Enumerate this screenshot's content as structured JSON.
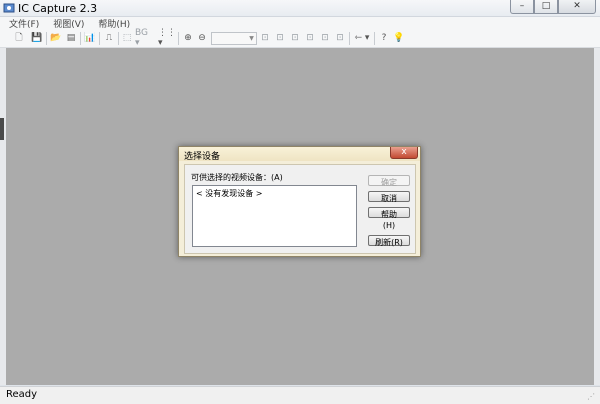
{
  "window": {
    "title": "IC Capture 2.3",
    "minimize_glyph": "–",
    "maximize_glyph": "□",
    "close_glyph": "✕"
  },
  "menu": {
    "items": [
      {
        "label": "文件(F)"
      },
      {
        "label": "视图(V)"
      },
      {
        "label": "帮助(H)"
      }
    ]
  },
  "toolbar": {
    "icons": {
      "new": "🗋",
      "save": "💾",
      "open_folder": "📂",
      "overlay": "▤",
      "histogram": "📊",
      "trigger": "⎍",
      "roi": "⬚",
      "bg_label": "BG ▾",
      "format_label": "⋮⋮ ▾",
      "zoom_in": "⊕",
      "zoom_out": "⊖",
      "snap1": "⊡",
      "snap2": "⊡",
      "snap3": "⊡",
      "snap4": "⊡",
      "snap5": "⊡",
      "snap6": "⊡",
      "usb": "⇽ ▾",
      "context_help": "?",
      "tip": "💡"
    }
  },
  "status": {
    "text": "Ready"
  },
  "dialog": {
    "title": "选择设备",
    "close_glyph": "x",
    "list_label": "可供选择的视频设备：(A)",
    "list_items": [
      "< 没有发现设备 >"
    ],
    "buttons": {
      "ok": "确定",
      "cancel": "取消",
      "help": "帮助(H)",
      "refresh": "刷新(R)"
    }
  },
  "colors": {
    "client_background": "#ababab",
    "dialog_frame": "#f4eed9",
    "close_button": "#c24a32"
  }
}
